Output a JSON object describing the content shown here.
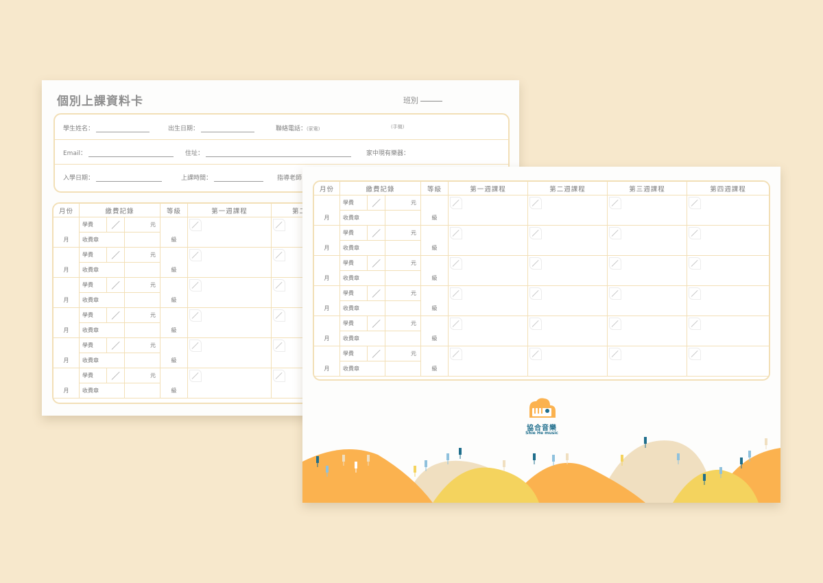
{
  "front_card": {
    "title": "個別上課資料卡",
    "class_label": "班別",
    "info": {
      "student_name": "學生姓名：",
      "birth_date": "出生日期：",
      "phone": "聯絡電話：",
      "phone_home": "(家電)",
      "phone_mobile": "(手機)",
      "email": "Email：",
      "address": "住址：",
      "instruments": "家中現有樂器：",
      "enroll_date": "入學日期：",
      "class_time": "上課時間：",
      "teacher": "指導老師"
    },
    "table_headers": [
      "月份",
      "繳費記錄",
      "等級",
      "第一週課程",
      "第二"
    ]
  },
  "back_card": {
    "table_headers": [
      "月份",
      "繳費記錄",
      "等級",
      "第一週課程",
      "第二週課程",
      "第三週課程",
      "第四週課程"
    ],
    "logo_name": "協合音樂",
    "logo_en": "Shie He music"
  },
  "row_labels": {
    "fee": "學費",
    "currency": "元",
    "stamp": "收費章",
    "month": "月",
    "grade": "級"
  },
  "colors": {
    "background": "#f7e8cc",
    "border": "#f2dfb6",
    "orange": "#fbb24f",
    "yellow": "#f4d35e",
    "beige": "#f0dfc0",
    "brand_blue": "#1f6e8c"
  }
}
